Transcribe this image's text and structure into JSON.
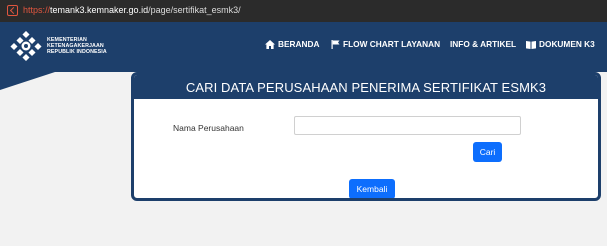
{
  "browser": {
    "url_scheme": "https://",
    "url_host": "temank3.kemnaker.go.id",
    "url_path": "/page/sertifikat_esmk3/"
  },
  "header": {
    "ministry_line1": "KEMENTERIAN",
    "ministry_line2": "KETENAGAKERJAAN",
    "ministry_line3": "REPUBLIK INDONESIA",
    "nav": {
      "beranda": "BERANDA",
      "flow_chart": "FLOW CHART LAYANAN",
      "info": "INFO & ARTIKEL",
      "dokumen": "DOKUMEN K3"
    }
  },
  "card": {
    "title": "CARI DATA PERUSAHAAN PENERIMA SERTIFIKAT ESMK3",
    "company_label": "Nama Perusahaan",
    "company_value": "",
    "search_button": "Cari",
    "back_button": "Kembali"
  },
  "colors": {
    "header_bg": "#1d3f6b",
    "button": "#0d6efd",
    "page_bg": "#f2f2f2"
  }
}
